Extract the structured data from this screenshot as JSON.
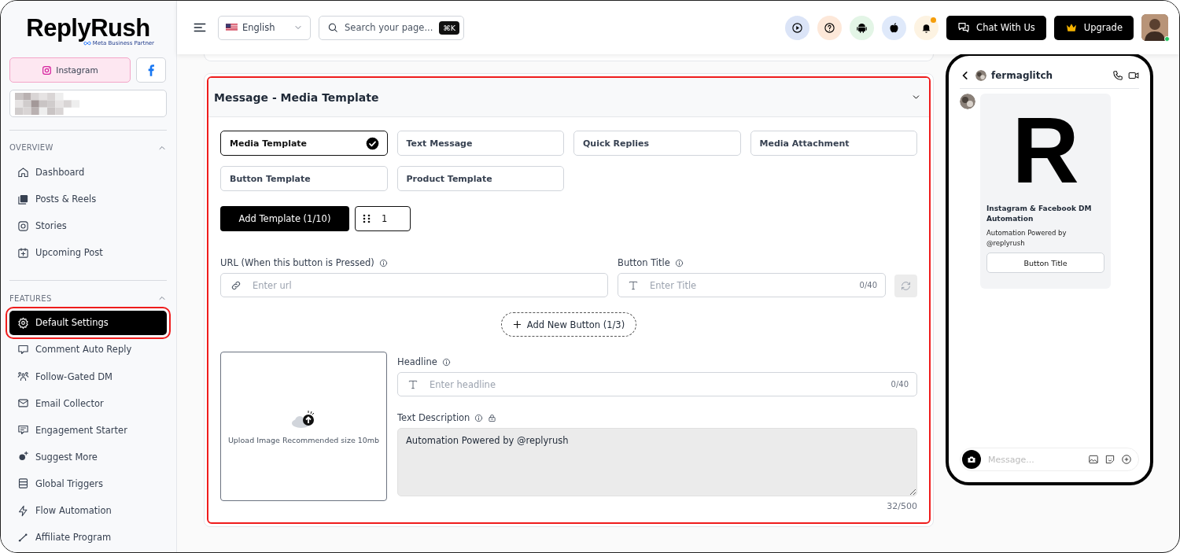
{
  "logo": {
    "name": "ReplyRush",
    "badge": "Meta Business Partner"
  },
  "platforms": [
    {
      "kind": "instagram",
      "label": "Instagram",
      "selected": true
    },
    {
      "kind": "facebook",
      "selected": false
    }
  ],
  "sidebar": {
    "sections": [
      {
        "title": "OVERVIEW",
        "expanded": true,
        "items": [
          {
            "label": "Dashboard",
            "selected": false,
            "highlighted": false
          },
          {
            "label": "Posts & Reels",
            "selected": false,
            "highlighted": false
          },
          {
            "label": "Stories",
            "selected": false,
            "highlighted": false
          },
          {
            "label": "Upcoming Post",
            "selected": false,
            "highlighted": false
          }
        ]
      },
      {
        "title": "FEATURES",
        "expanded": true,
        "items": [
          {
            "label": "Default Settings",
            "selected": true,
            "highlighted": true
          },
          {
            "label": "Comment Auto Reply",
            "selected": false,
            "highlighted": false
          },
          {
            "label": "Follow-Gated DM",
            "selected": false,
            "highlighted": false
          },
          {
            "label": "Email Collector",
            "selected": false,
            "highlighted": false
          },
          {
            "label": "Engagement Starter",
            "selected": false,
            "highlighted": false
          },
          {
            "label": "Suggest More",
            "selected": false,
            "highlighted": false
          },
          {
            "label": "Global Triggers",
            "selected": false,
            "highlighted": false
          },
          {
            "label": "Flow Automation",
            "selected": false,
            "highlighted": false
          },
          {
            "label": "Affiliate Program",
            "selected": false,
            "highlighted": false
          }
        ]
      }
    ]
  },
  "topbar": {
    "language": "English",
    "search": {
      "placeholder": "Search your page...",
      "shortcut": "⌘K"
    },
    "notification": true,
    "online": true,
    "buttons": [
      {
        "kind": "chat",
        "label": "Chat With Us"
      },
      {
        "kind": "upgrade",
        "label": "Upgrade"
      }
    ]
  },
  "card": {
    "title": "Message - Media Template",
    "expanded": true,
    "highlighted": true,
    "template_types": [
      {
        "label": "Media Template",
        "selected": true
      },
      {
        "label": "Text Message",
        "selected": false
      },
      {
        "label": "Quick Replies",
        "selected": false
      },
      {
        "label": "Media Attachment",
        "selected": false
      },
      {
        "label": "Button Template",
        "selected": false
      },
      {
        "label": "Product Template",
        "selected": false
      }
    ],
    "add_template": "Add Template (1/10)",
    "template_tabs": [
      {
        "label": "1",
        "selected": true
      }
    ],
    "url_field": {
      "label": "URL (When this button is Pressed)",
      "placeholder": "Enter url"
    },
    "button_title_field": {
      "label": "Button Title",
      "placeholder": "Enter Title",
      "counter": "0/40"
    },
    "add_button": "Add New Button (1/3)",
    "upload": {
      "text": "Upload Image Recommended size 10mb"
    },
    "headline_field": {
      "label": "Headline",
      "placeholder": "Enter headline",
      "counter": "0/40"
    },
    "description_field": {
      "label": "Text Description",
      "value": "Automation Powered by @replyrush",
      "counter": "32/500"
    }
  },
  "preview": {
    "username": "fermaglitch",
    "logo_letter": "R",
    "title": "Instagram & Facebook DM Automation",
    "text": "Automation Powered by @replyrush",
    "button": "Button Title",
    "message_placeholder": "Message..."
  }
}
